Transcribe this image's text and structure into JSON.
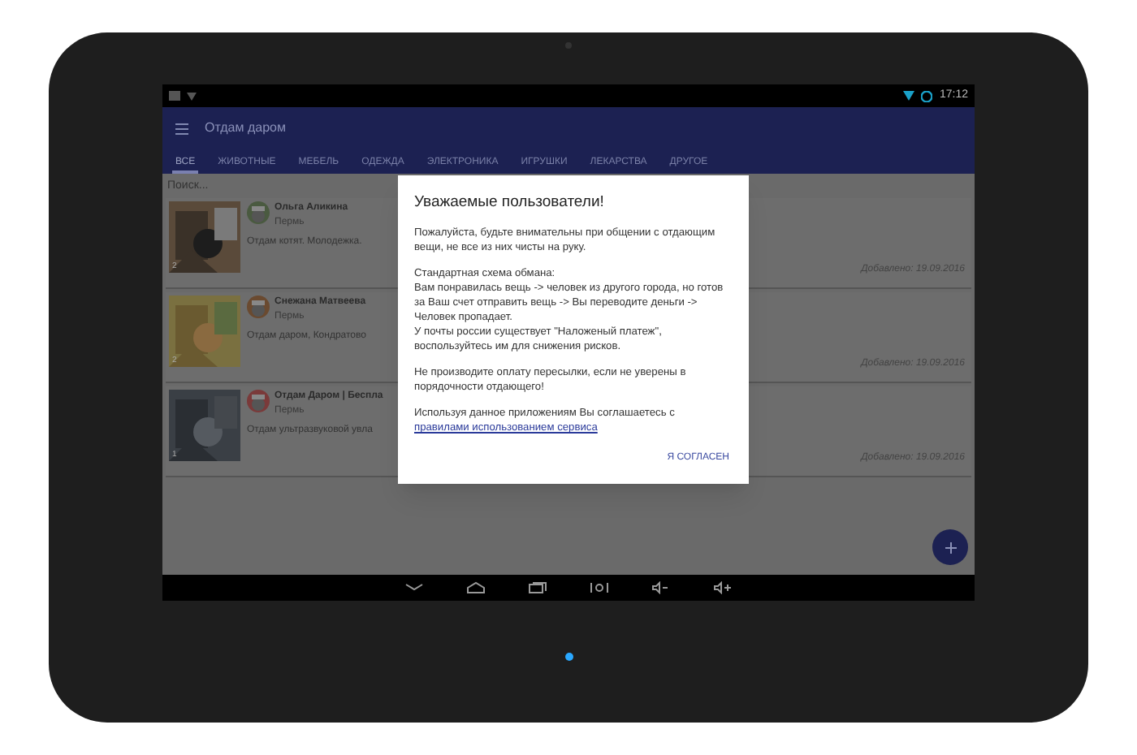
{
  "status_bar": {
    "time": "17:12"
  },
  "app_bar": {
    "title": "Отдам даром"
  },
  "tabs": [
    {
      "label": "ВСЕ",
      "selected": true
    },
    {
      "label": "ЖИВОТНЫЕ",
      "selected": false
    },
    {
      "label": "МЕБЕЛЬ",
      "selected": false
    },
    {
      "label": "ОДЕЖДА",
      "selected": false
    },
    {
      "label": "ЭЛЕКТРОНИКА",
      "selected": false
    },
    {
      "label": "ИГРУШКИ",
      "selected": false
    },
    {
      "label": "ЛЕКАРСТВА",
      "selected": false
    },
    {
      "label": "ДРУГОЕ",
      "selected": false
    }
  ],
  "search": {
    "placeholder": "Поиск..."
  },
  "listings": [
    {
      "photo_count": "2",
      "author": "Ольга Аликина",
      "city": "Пермь",
      "text": "Отдам котят. Молодежка.",
      "date": "Добавлено: 19.09.2016"
    },
    {
      "photo_count": "2",
      "author": "Снежана Матвеева",
      "city": "Пермь",
      "text": "Отдам даром, Кондратово",
      "date": "Добавлено: 19.09.2016"
    },
    {
      "photo_count": "1",
      "author": "Отдам Даром | Беспла",
      "city": "Пермь",
      "text": "Отдам ультразвуковой увла",
      "date": "Добавлено: 19.09.2016"
    }
  ],
  "dialog": {
    "title": "Уважаемые пользователи!",
    "paragraphs": [
      "Пожалуйста, будьте внимательны при общении с отдающим вещи, не все из них чисты на руку.",
      "Стандартная схема обмана:\nВам понравилась вещь -> человек из другого города, но готов за Ваш счет отправить вещь -> Вы переводите деньги -> Человек пропадает.\nУ почты россии существует \"Наложеный платеж\", воспользуйтесь им для снижения рисков.",
      "Не производите оплату пересылки, если не уверены в порядочности отдающего!"
    ],
    "agreement": "Используя данное приложениям Вы соглашаетесь с",
    "link": "правилами использованием сервиса",
    "button": "Я СОГЛАСЕН"
  }
}
